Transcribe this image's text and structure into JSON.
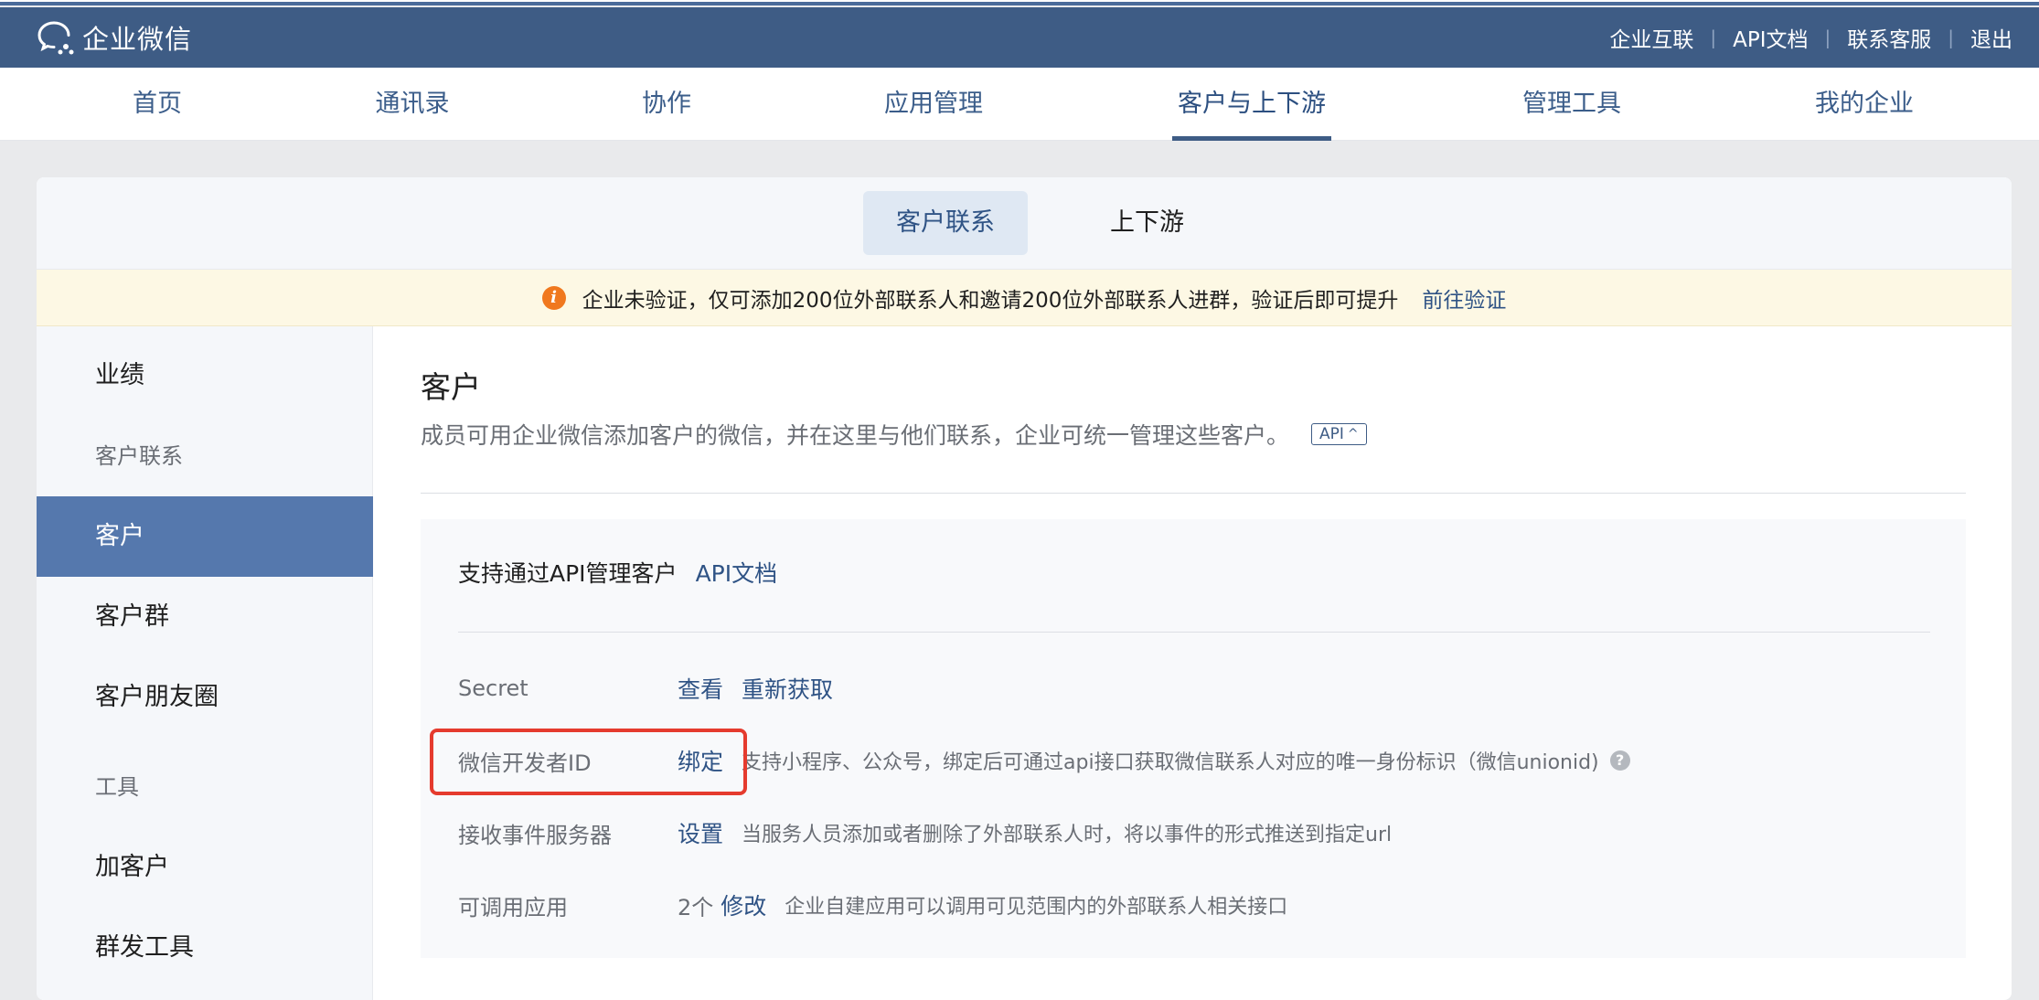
{
  "app": {
    "logo_text": "企业微信",
    "header_links": [
      "企业互联",
      "API文档",
      "联系客服",
      "退出"
    ]
  },
  "nav": {
    "items": [
      "首页",
      "通讯录",
      "协作",
      "应用管理",
      "客户与上下游",
      "管理工具",
      "我的企业"
    ],
    "active": "客户与上下游"
  },
  "subtabs": {
    "active_label": "客户联系",
    "other_label": "上下游"
  },
  "notice": {
    "icon": "info-icon",
    "text": "企业未验证，仅可添加200位外部联系人和邀请200位外部联系人进群，验证后即可提升",
    "link": "前往验证"
  },
  "sidebar": {
    "items": [
      {
        "label": "业绩",
        "type": "item"
      },
      {
        "label": "客户联系",
        "type": "group"
      },
      {
        "label": "客户",
        "type": "item",
        "active": true
      },
      {
        "label": "客户群",
        "type": "item"
      },
      {
        "label": "客户朋友圈",
        "type": "item"
      },
      {
        "label": "工具",
        "type": "group"
      },
      {
        "label": "加客户",
        "type": "item"
      },
      {
        "label": "群发工具",
        "type": "item"
      }
    ]
  },
  "main": {
    "title": "客户",
    "description": "成员可用企业微信添加客户的微信，并在这里与他们联系，企业可统一管理这些客户。",
    "api_chip": "API",
    "panel": {
      "heading": "支持通过API管理客户",
      "heading_link": "API文档",
      "rows": [
        {
          "label": "Secret",
          "actions": [
            "查看",
            "重新获取"
          ],
          "desc": ""
        },
        {
          "label": "微信开发者ID",
          "actions": [
            "绑定"
          ],
          "desc": "支持小程序、公众号，绑定后可通过api接口获取微信联系人对应的唯一身份标识（微信unionid)"
        },
        {
          "label": "接收事件服务器",
          "actions": [
            "设置"
          ],
          "desc": "当服务人员添加或者删除了外部联系人时，将以事件的形式推送到指定url"
        },
        {
          "label": "可调用应用",
          "count": "2个",
          "actions": [
            "修改"
          ],
          "desc": "企业自建应用可以调用可见范围内的外部联系人相关接口"
        }
      ]
    }
  },
  "colors": {
    "header_bg": "#3e5c85",
    "accent": "#2f5385",
    "sidebar_active": "#5578ad",
    "highlight": "#e53b2e",
    "notice_bg": "#fdf8e4"
  }
}
